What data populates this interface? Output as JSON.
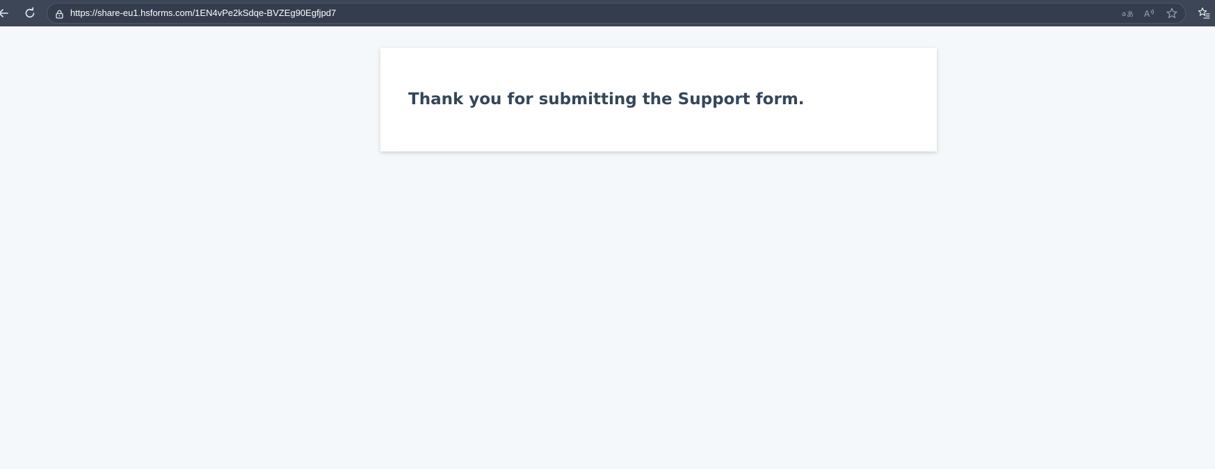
{
  "browser": {
    "url": "https://share-eu1.hsforms.com/1EN4vPe2kSdqe-BVZEg90Egfjpd7",
    "icons": [
      "back-arrow-icon",
      "refresh-icon",
      "lock-icon",
      "translate-icon",
      "read-aloud-icon",
      "star-icon",
      "favorites-icon"
    ]
  },
  "form": {
    "message": "Thank you for submitting the Support form."
  },
  "colors": {
    "page_background": "#f5f8fa",
    "browser_bar": "#3c4657",
    "heading": "#33475b"
  }
}
